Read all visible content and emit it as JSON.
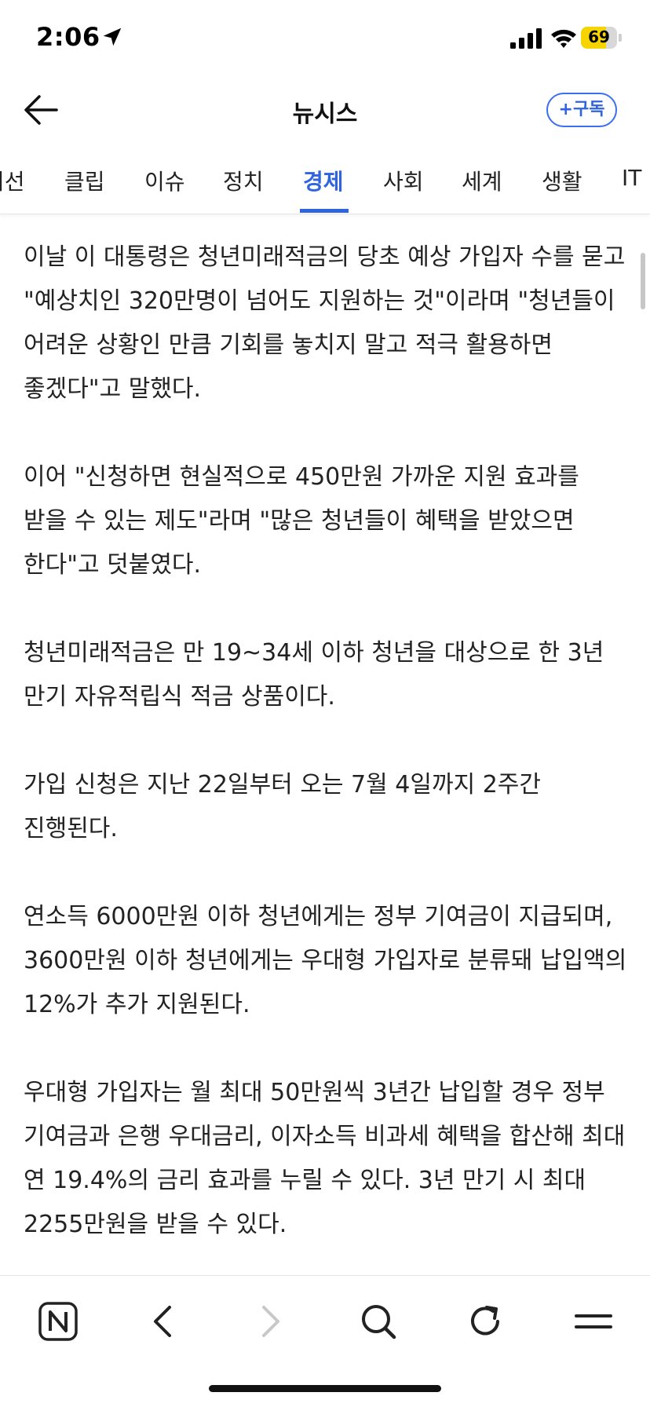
{
  "status_bar": {
    "time": "2:06",
    "battery_level": "69"
  },
  "header": {
    "title": "뉴시스",
    "subscribe_label": "+구독"
  },
  "tabs": [
    {
      "label": "시선"
    },
    {
      "label": "클립"
    },
    {
      "label": "이슈"
    },
    {
      "label": "정치"
    },
    {
      "label": "경제",
      "active": true
    },
    {
      "label": "사회"
    },
    {
      "label": "세계"
    },
    {
      "label": "생활"
    },
    {
      "label": "IT"
    }
  ],
  "article": {
    "paragraphs": [
      "이날 이 대통령은 청년미래적금의 당초 예상 가입자 수를 묻고 \"예상치인 320만명이 넘어도 지원하는 것\"이라며 \"청년들이 어려운 상황인 만큼 기회를 놓치지 말고 적극 활용하면 좋겠다\"고 말했다.",
      "이어 \"신청하면 현실적으로 450만원 가까운 지원 효과를 받을 수 있는 제도\"라며 \"많은 청년들이 혜택을 받았으면 한다\"고 덧붙였다.",
      "청년미래적금은 만 19~34세 이하 청년을 대상으로 한 3년 만기 자유적립식 적금 상품이다.",
      "가입 신청은 지난 22일부터 오는 7월 4일까지 2주간 진행된다.",
      "연소득 6000만원 이하 청년에게는 정부 기여금이 지급되며, 3600만원 이하 청년에게는 우대형 가입자로 분류돼 납입액의 12%가 추가 지원된다.",
      "우대형 가입자는 월 최대 50만원씩 3년간 납입할 경우 정부 기여금과 은행 우대금리, 이자소득 비과세 혜택을 합산해 최대 연 19.4%의 금리 효과를 누릴 수 있다. 3년 만기 시 최대 2255만원을 받을 수 있다."
    ]
  },
  "toolbar": {
    "icons": [
      "naver-n-icon",
      "back-chevron-icon",
      "forward-chevron-icon",
      "search-icon",
      "refresh-icon",
      "menu-icon"
    ]
  },
  "colors": {
    "accent": "#2f63e0",
    "battery": "#f6d400",
    "text": "#222222"
  }
}
